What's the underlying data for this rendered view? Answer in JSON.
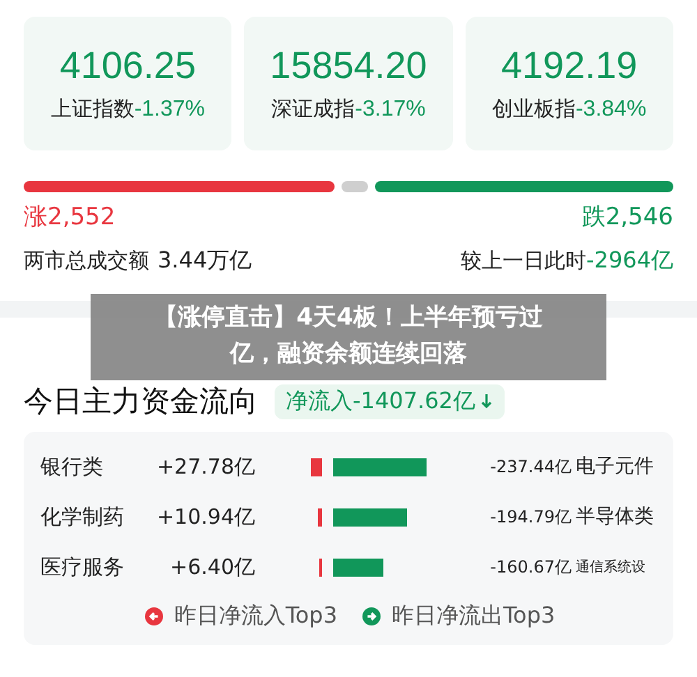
{
  "indices": [
    {
      "value": "4106.25",
      "name": "上证指数",
      "change": "-1.37%"
    },
    {
      "value": "15854.20",
      "name": "深证成指",
      "change": "-3.17%"
    },
    {
      "value": "4192.19",
      "name": "创业板指",
      "change": "-3.84%"
    }
  ],
  "breadth": {
    "advancing": {
      "count": "涨2,552"
    },
    "declining": {
      "count": "跌2,546"
    }
  },
  "turnover": {
    "label": "两市总成交额",
    "value": "3.44万亿",
    "compare_label": "较上一日此时",
    "compare_value": "-2964亿"
  },
  "headline": "【涨停直击】4天4板！上半年预亏过亿，融资余额连续回落",
  "flow": {
    "title": "今日主力资金流向",
    "net": "净流入-1407.62亿",
    "rows": [
      {
        "inflow": {
          "sector": "银行类",
          "amount": "+27.78亿"
        },
        "outflow": {
          "amount": "-237.44亿",
          "sector": "电子元件"
        }
      },
      {
        "inflow": {
          "sector": "化学制药",
          "amount": "+10.94亿"
        },
        "outflow": {
          "amount": "-194.79亿",
          "sector": "半导体类"
        }
      },
      {
        "inflow": {
          "sector": "医疗服务",
          "amount": "+6.40亿"
        },
        "outflow": {
          "amount": "-160.67亿",
          "sector": "通信系统设"
        }
      }
    ],
    "legend": [
      "昨日净流入Top3",
      "昨日净流出Top3"
    ]
  }
}
